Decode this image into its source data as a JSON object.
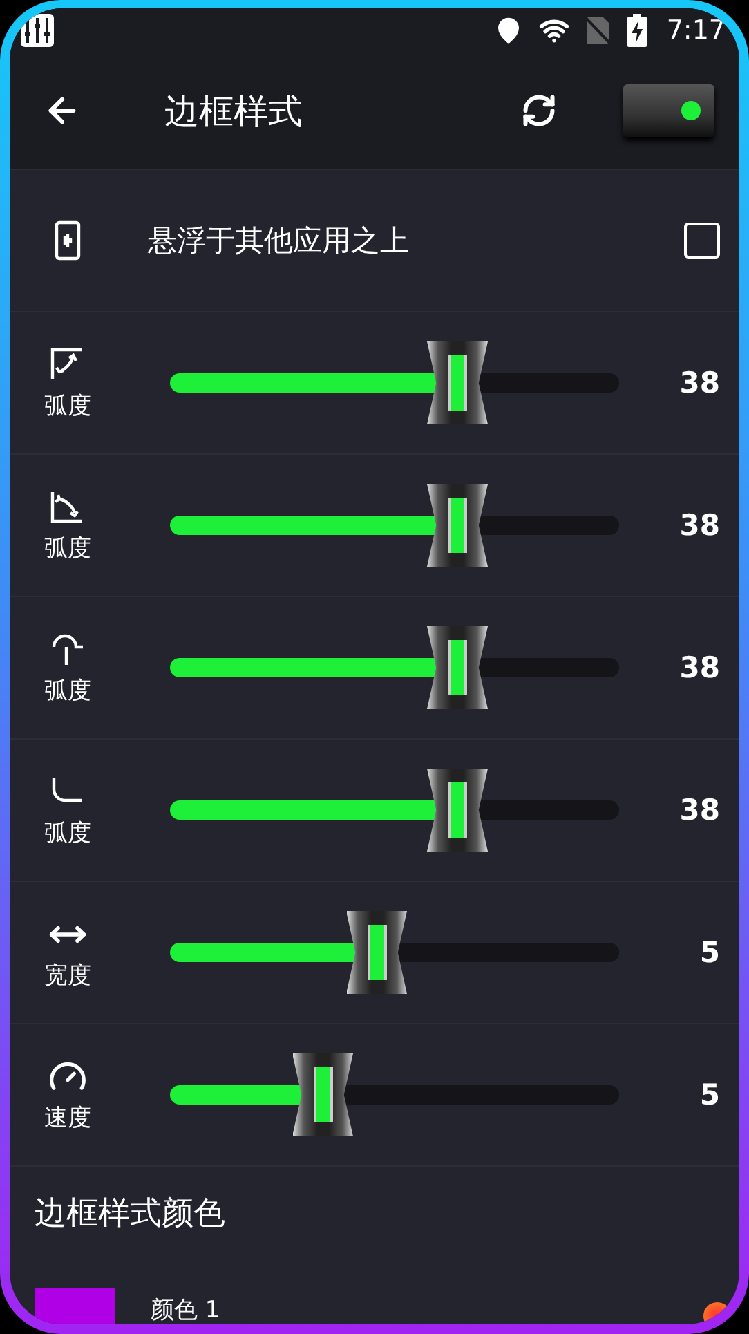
{
  "status_bar": {
    "time": "7:17"
  },
  "header": {
    "title": "边框样式",
    "switch_on": true
  },
  "overlay_option": {
    "label": "悬浮于其他应用之上",
    "checked": false
  },
  "sliders": [
    {
      "kind": "corner-top-left",
      "label": "弧度",
      "level": 0.64,
      "value": "38"
    },
    {
      "kind": "corner-bottom-left",
      "label": "弧度",
      "level": 0.64,
      "value": "38"
    },
    {
      "kind": "corner-top-right",
      "label": "弧度",
      "level": 0.64,
      "value": "38"
    },
    {
      "kind": "corner-bottom-right",
      "label": "弧度",
      "level": 0.64,
      "value": "38"
    },
    {
      "kind": "width",
      "label": "宽度",
      "level": 0.46,
      "value": "5"
    },
    {
      "kind": "speed",
      "label": "速度",
      "level": 0.34,
      "value": "5"
    }
  ],
  "color_section": {
    "title": "边框样式颜色",
    "colors": [
      {
        "label": "颜色 1",
        "color": "#b000e6"
      }
    ]
  }
}
